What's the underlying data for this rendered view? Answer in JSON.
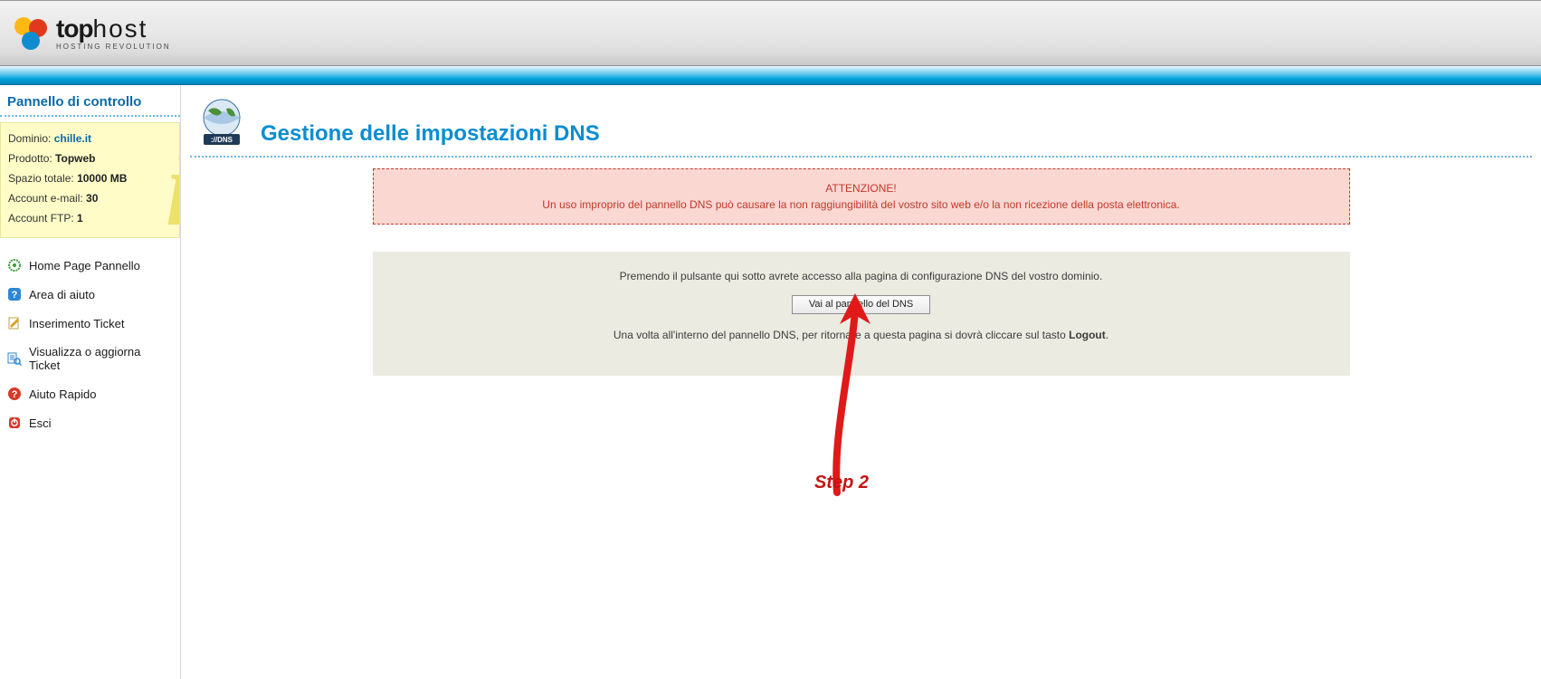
{
  "brand": {
    "name_strong": "top",
    "name_thin": "host",
    "tagline": "HOSTING REVOLUTION"
  },
  "sidebar": {
    "title": "Pannello di controllo",
    "info": {
      "domain_label": "Dominio:",
      "domain_value": "chille.it",
      "product_label": "Prodotto:",
      "product_value": "Topweb",
      "space_label": "Spazio totale:",
      "space_value": "10000 MB",
      "email_label": "Account e-mail:",
      "email_value": "30",
      "ftp_label": "Account FTP:",
      "ftp_value": "1"
    },
    "nav": {
      "home": "Home Page Pannello",
      "help_area": "Area di aiuto",
      "insert_ticket": "Inserimento Ticket",
      "view_ticket": "Visualizza o aggiorna Ticket",
      "quick_help": "Aiuto Rapido",
      "logout": "Esci"
    }
  },
  "page": {
    "title": "Gestione delle impostazioni DNS",
    "warn_title": "ATTENZIONE!",
    "warn_body": "Un uso improprio del pannello DNS può causare la non raggiungibilità del vostro sito web e/o la non ricezione della posta elettronica.",
    "action_intro": "Premendo il pulsante qui sotto avrete accesso alla pagina di configurazione DNS del vostro dominio.",
    "action_button": "Vai al pannello del DNS",
    "action_note_pre": "Una volta all'interno del pannello DNS, per ritornare a questa pagina si dovrà cliccare sul tasto ",
    "action_note_bold": "Logout",
    "action_note_post": "."
  },
  "annotation": {
    "step_label": "Step 2"
  }
}
